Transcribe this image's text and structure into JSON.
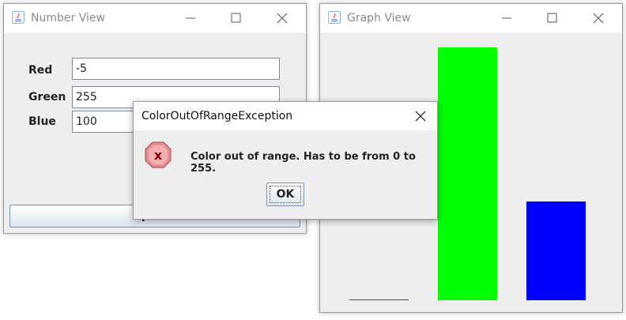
{
  "number_view": {
    "title": "Number View",
    "fields": [
      {
        "label": "Red",
        "value": "-5"
      },
      {
        "label": "Green",
        "value": "255"
      },
      {
        "label": "Blue",
        "value": "100"
      }
    ],
    "update_label": "Update"
  },
  "graph_view": {
    "title": "Graph View",
    "bars": [
      {
        "color": "#ff0000",
        "value": -5
      },
      {
        "color": "#00ff00",
        "value": 255
      },
      {
        "color": "#0000ff",
        "value": 100
      }
    ],
    "max_value": 255
  },
  "dialog": {
    "title": "ColorOutOfRangeException",
    "message": "Color out of range. Has to be from 0 to 255.",
    "ok_label": "OK"
  }
}
